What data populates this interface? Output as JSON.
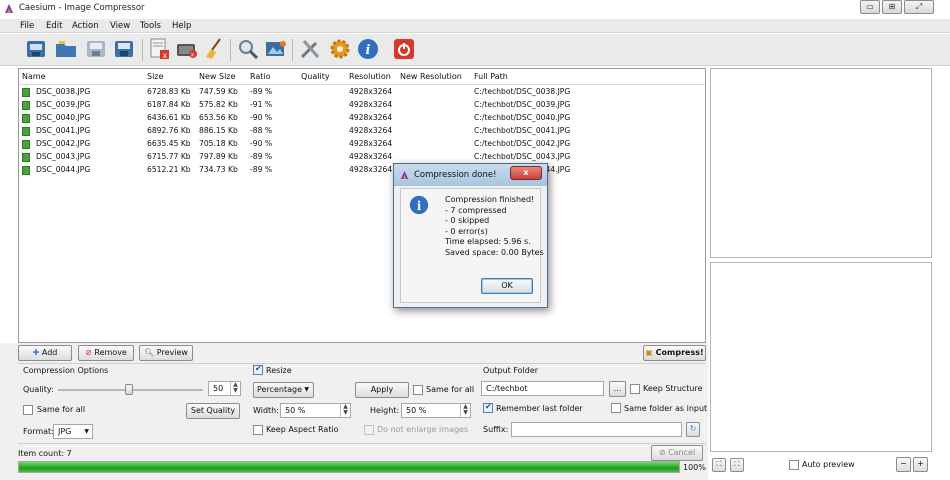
{
  "window": {
    "title": "Caesium - Image Compressor",
    "buttons": [
      "▭",
      "⊞",
      "⤢"
    ]
  },
  "menu": [
    "File",
    "Edit",
    "Action",
    "View",
    "Tools",
    "Help"
  ],
  "toolbar_icons": [
    "open-file-icon",
    "open-folder-icon",
    "save-icon",
    "save-all-icon",
    "remove-icon",
    "clear-list-icon",
    "broom-icon",
    "search-icon",
    "preview-image-icon",
    "tools-icon",
    "settings-gear-icon",
    "info-icon",
    "power-icon"
  ],
  "table": {
    "headers": [
      "Name",
      "Size",
      "New Size",
      "Ratio",
      "Quality",
      "Resolution",
      "New Resolution",
      "Full Path"
    ],
    "rows": [
      {
        "name": "DSC_0038.JPG",
        "size": "6728.83 Kb",
        "new_size": "747.59 Kb",
        "ratio": "-89 %",
        "quality": "",
        "resolution": "4928x3264",
        "new_resolution": "",
        "path": "C:/techbot/DSC_0038.JPG"
      },
      {
        "name": "DSC_0039.JPG",
        "size": "6187.84 Kb",
        "new_size": "575.82 Kb",
        "ratio": "-91 %",
        "quality": "",
        "resolution": "4928x3264",
        "new_resolution": "",
        "path": "C:/techbot/DSC_0039.JPG"
      },
      {
        "name": "DSC_0040.JPG",
        "size": "6436.61 Kb",
        "new_size": "653.56 Kb",
        "ratio": "-90 %",
        "quality": "",
        "resolution": "4928x3264",
        "new_resolution": "",
        "path": "C:/techbot/DSC_0040.JPG"
      },
      {
        "name": "DSC_0041.JPG",
        "size": "6892.76 Kb",
        "new_size": "886.15 Kb",
        "ratio": "-88 %",
        "quality": "",
        "resolution": "4928x3264",
        "new_resolution": "",
        "path": "C:/techbot/DSC_0041.JPG"
      },
      {
        "name": "DSC_0042.JPG",
        "size": "6635.45 Kb",
        "new_size": "705.18 Kb",
        "ratio": "-90 %",
        "quality": "",
        "resolution": "4928x3264",
        "new_resolution": "",
        "path": "C:/techbot/DSC_0042.JPG"
      },
      {
        "name": "DSC_0043.JPG",
        "size": "6715.77 Kb",
        "new_size": "797.89 Kb",
        "ratio": "-89 %",
        "quality": "",
        "resolution": "4928x3264",
        "new_resolution": "",
        "path": "C:/techbot/DSC_0043.JPG"
      },
      {
        "name": "DSC_0044.JPG",
        "size": "6512.21 Kb",
        "new_size": "734.73 Kb",
        "ratio": "-89 %",
        "quality": "",
        "resolution": "4928x3264",
        "new_resolution": "",
        "path": "C:/techbot/DSC_0044.JPG"
      }
    ]
  },
  "list_buttons": {
    "add": "Add",
    "remove": "Remove",
    "preview": "Preview",
    "compress": "Compress!"
  },
  "compression": {
    "section_title": "Compression Options",
    "quality_label": "Quality:",
    "quality_value": "50",
    "quality_slider_level": 0.5,
    "same_for_all": "Same for all",
    "set_quality": "Set Quality",
    "format_label": "Format:",
    "format_value": "JPG"
  },
  "resize": {
    "checkbox_label": "Resize",
    "mode": "Percentage",
    "apply": "Apply",
    "same_for_all": "Same for all",
    "width_label": "Width:",
    "width_value": "50 %",
    "height_label": "Height:",
    "height_value": "50 %",
    "keep_aspect": "Keep Aspect Ratio",
    "no_enlarge": "Do not enlarge images"
  },
  "output": {
    "section_title": "Output Folder",
    "folder_value": "C:/techbot",
    "browse": "...",
    "keep_structure": "Keep Structure",
    "remember_last": "Remember last folder",
    "same_as_input": "Same folder as input",
    "suffix_label": "Suffix:",
    "suffix_value": ""
  },
  "status": {
    "item_count": "Item count: 7",
    "cancel": "Cancel",
    "progress_text": "100%",
    "progress_value": 1.0,
    "auto_preview": "Auto preview"
  },
  "dialog": {
    "title": "Compression done!",
    "close": "x",
    "lines": [
      "Compression finished!",
      "- 7 compressed",
      "- 0 skipped",
      "- 0 error(s)",
      "Time elapsed: 5.96 s.",
      "Saved space: 0.00 Bytes"
    ],
    "ok": "OK"
  },
  "colors": {
    "accent": "#1f9a1f",
    "title_bar_blue": "#a9c4e0",
    "close_red": "#c9413a"
  }
}
